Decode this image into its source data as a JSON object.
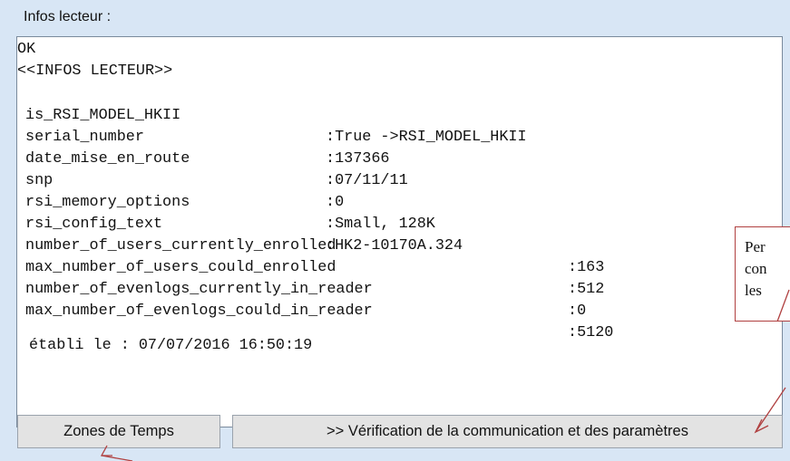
{
  "group": {
    "label": "Infos lecteur :"
  },
  "output": {
    "status": "OK",
    "header": "<<INFOS LECTEUR>>",
    "rows": [
      {
        "key": "is_RSI_MODEL_HKII",
        "value": ":True ->RSI_MODEL_HKII"
      },
      {
        "key": "serial_number",
        "value": ":137366"
      },
      {
        "key": "date_mise_en_route",
        "value": ":07/11/11"
      },
      {
        "key": "snp",
        "value": ":0"
      },
      {
        "key": "rsi_memory_options",
        "value": ":Small, 128K"
      },
      {
        "key": "rsi_config_text",
        "value": ":HK2-10170A.324"
      },
      {
        "key": "number_of_users_currently_enrolled",
        "value": ":163"
      },
      {
        "key": "max_number_of_users_could_enrolled",
        "value": ":512"
      },
      {
        "key": "number_of_evenlogs_currently_in_reader",
        "value": ":0"
      },
      {
        "key": "max_number_of_evenlogs_could_in_reader",
        "value": ":5120"
      }
    ],
    "footer": "établi le : 07/07/2016 16:50:19"
  },
  "callout": {
    "lines": [
      "Per",
      "con",
      "les"
    ]
  },
  "buttons": {
    "zones": "Zones de Temps",
    "verify": ">> Vérification de la communication et des paramètres"
  },
  "colors": {
    "callout_border": "#b04040",
    "arrow": "#b04040"
  }
}
